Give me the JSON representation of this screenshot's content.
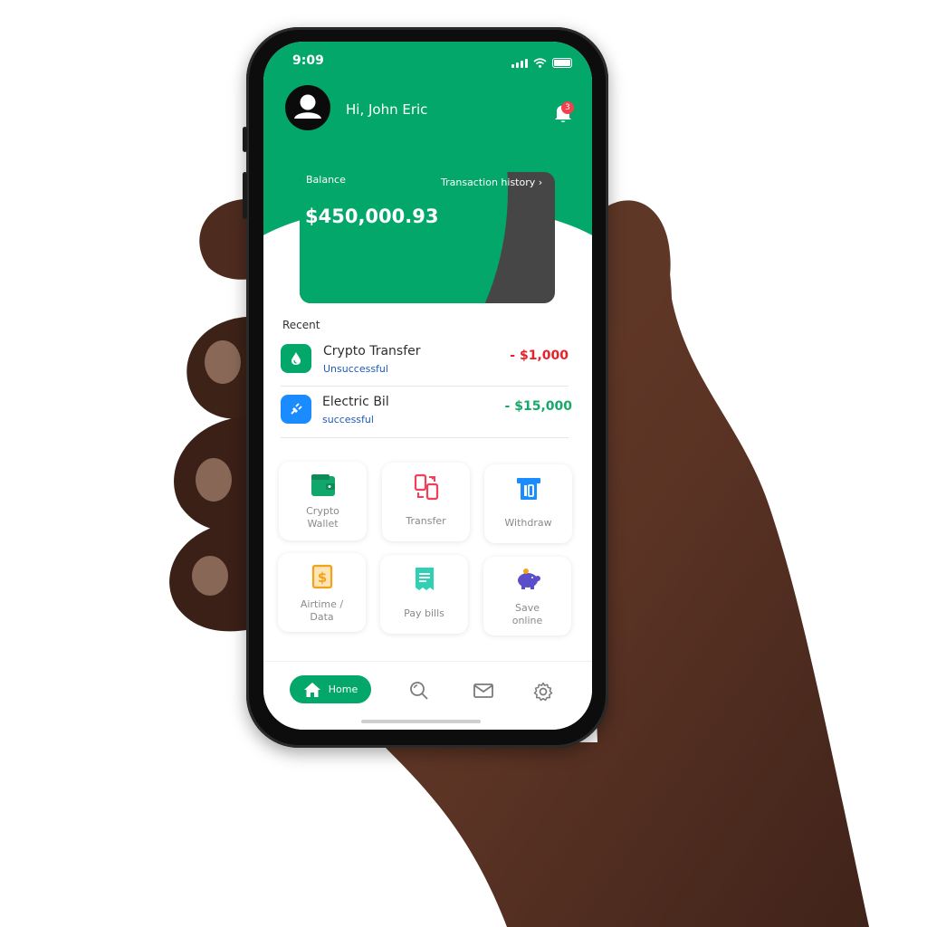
{
  "status_bar": {
    "time": "9:09"
  },
  "header": {
    "greeting": "Hi, John Eric",
    "notification_count": "3"
  },
  "balance": {
    "label": "Balance",
    "value": "$450,000.93",
    "history_link": "Transaction history ›"
  },
  "recent": {
    "title": "Recent",
    "items": [
      {
        "name": "Crypto Transfer",
        "status": "Unsuccessful",
        "amount": "- $1,000",
        "amount_color": "#e8202a",
        "icon": "crypto-drop-icon",
        "icon_bg": "#03a76a"
      },
      {
        "name": "Electric Bil",
        "status": "successful",
        "amount": "- $15,000",
        "amount_color": "#17a86b",
        "icon": "electric-plug-icon",
        "icon_bg": "#1a8cff"
      }
    ]
  },
  "services": [
    {
      "label": "Crypto\nWallet",
      "icon": "wallet-icon",
      "color": "#12a76a"
    },
    {
      "label": "Transfer",
      "icon": "transfer-icon",
      "color": "#f0405a"
    },
    {
      "label": "Withdraw",
      "icon": "atm-icon",
      "color": "#1a8cff"
    },
    {
      "label": "Airtime /\nData",
      "icon": "dollar-card-icon",
      "color": "#f4a21a"
    },
    {
      "label": "Pay bills",
      "icon": "receipt-icon",
      "color": "#2fd0b4"
    },
    {
      "label": "Save\nonline",
      "icon": "piggy-bank-icon",
      "color": "#5b4fc9"
    }
  ],
  "nav": {
    "home_label": "Home",
    "items": [
      "home-icon",
      "search-icon",
      "mail-icon",
      "settings-icon"
    ]
  },
  "colors": {
    "brand": "#03a76a",
    "card_dark": "#464646"
  }
}
